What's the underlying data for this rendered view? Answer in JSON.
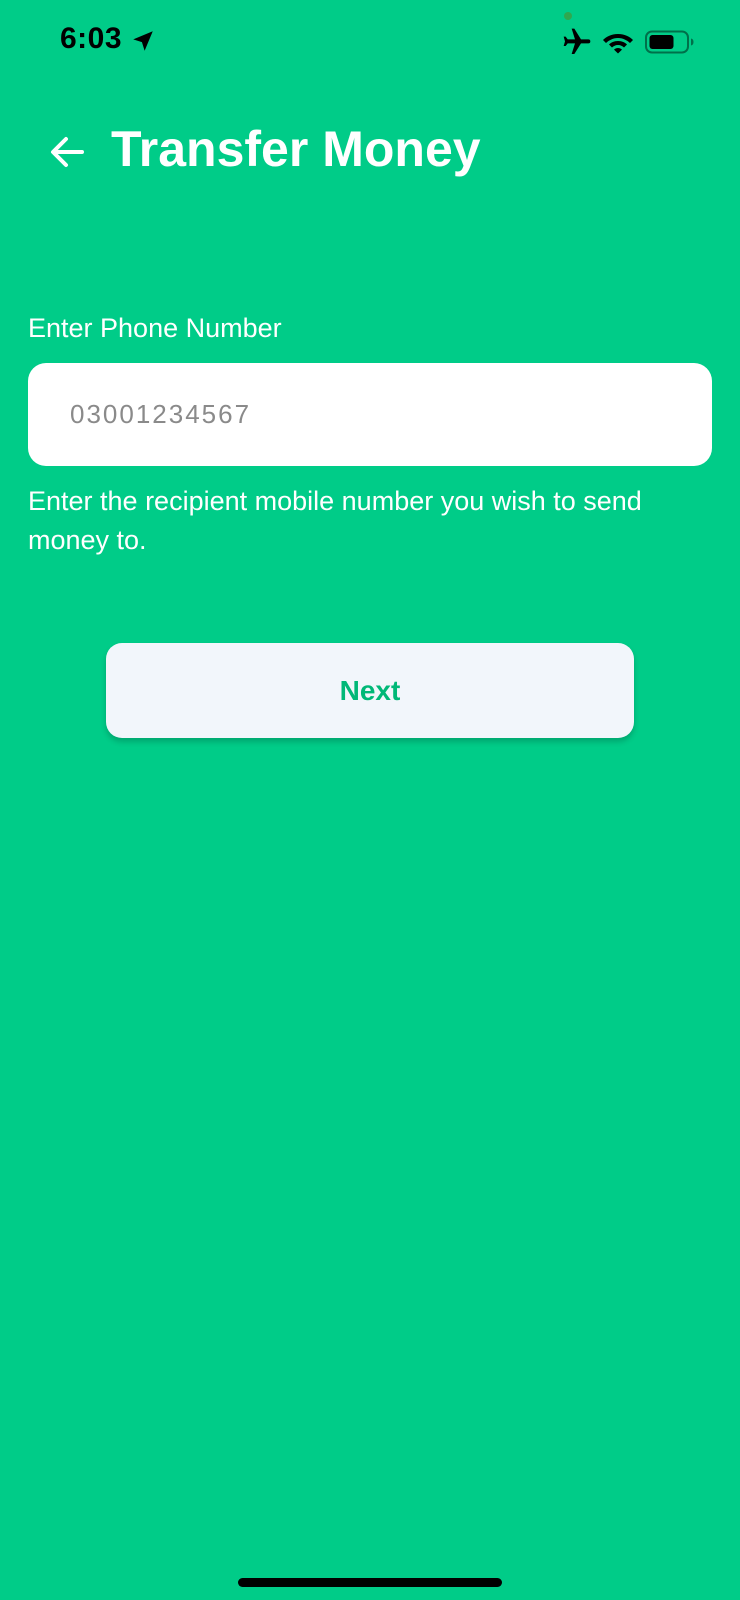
{
  "status_bar": {
    "time": "6:03",
    "icons": [
      "location-arrow-icon",
      "airplane-icon",
      "wifi-icon",
      "battery-icon"
    ]
  },
  "header": {
    "back_icon": "arrow-left-icon",
    "title": "Transfer Money"
  },
  "form": {
    "phone_label": "Enter Phone Number",
    "phone_placeholder": "03001234567",
    "phone_value": "",
    "help_text": "Enter the recipient mobile number you wish to send money to."
  },
  "actions": {
    "next_label": "Next"
  },
  "colors": {
    "background": "#00CC88",
    "button_bg": "#F2F6FB",
    "button_text": "#00B877",
    "input_bg": "#FFFFFF"
  }
}
